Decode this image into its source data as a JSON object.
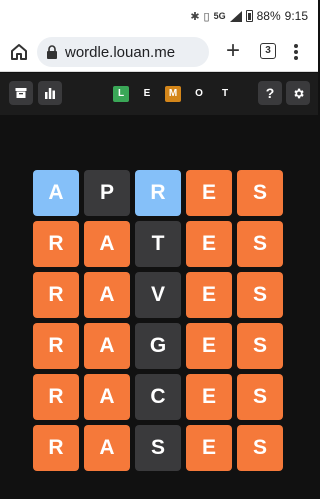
{
  "status_bar": {
    "network": "5G",
    "battery": "88%",
    "time": "9:15"
  },
  "browser": {
    "url": "wordle.louan.me",
    "tab_count": "3"
  },
  "header": {
    "logo_letters": [
      {
        "char": "L",
        "color": "#3aa757"
      },
      {
        "char": "E",
        "color": null
      },
      {
        "char": "M",
        "color": "#d4861a"
      },
      {
        "char": "O",
        "color": null
      },
      {
        "char": "T",
        "color": null
      }
    ],
    "help_label": "?"
  },
  "colors": {
    "correct": "#f5793a",
    "present": "#85c0f9",
    "absent": "#3a3a3c",
    "background": "#111111"
  },
  "board": {
    "rows": [
      [
        {
          "letter": "A",
          "state": "present"
        },
        {
          "letter": "P",
          "state": "absent"
        },
        {
          "letter": "R",
          "state": "present"
        },
        {
          "letter": "E",
          "state": "correct"
        },
        {
          "letter": "S",
          "state": "correct"
        }
      ],
      [
        {
          "letter": "R",
          "state": "correct"
        },
        {
          "letter": "A",
          "state": "correct"
        },
        {
          "letter": "T",
          "state": "absent"
        },
        {
          "letter": "E",
          "state": "correct"
        },
        {
          "letter": "S",
          "state": "correct"
        }
      ],
      [
        {
          "letter": "R",
          "state": "correct"
        },
        {
          "letter": "A",
          "state": "correct"
        },
        {
          "letter": "V",
          "state": "absent"
        },
        {
          "letter": "E",
          "state": "correct"
        },
        {
          "letter": "S",
          "state": "correct"
        }
      ],
      [
        {
          "letter": "R",
          "state": "correct"
        },
        {
          "letter": "A",
          "state": "correct"
        },
        {
          "letter": "G",
          "state": "absent"
        },
        {
          "letter": "E",
          "state": "correct"
        },
        {
          "letter": "S",
          "state": "correct"
        }
      ],
      [
        {
          "letter": "R",
          "state": "correct"
        },
        {
          "letter": "A",
          "state": "correct"
        },
        {
          "letter": "C",
          "state": "absent"
        },
        {
          "letter": "E",
          "state": "correct"
        },
        {
          "letter": "S",
          "state": "correct"
        }
      ],
      [
        {
          "letter": "R",
          "state": "correct"
        },
        {
          "letter": "A",
          "state": "correct"
        },
        {
          "letter": "S",
          "state": "absent"
        },
        {
          "letter": "E",
          "state": "correct"
        },
        {
          "letter": "S",
          "state": "correct"
        }
      ]
    ]
  }
}
